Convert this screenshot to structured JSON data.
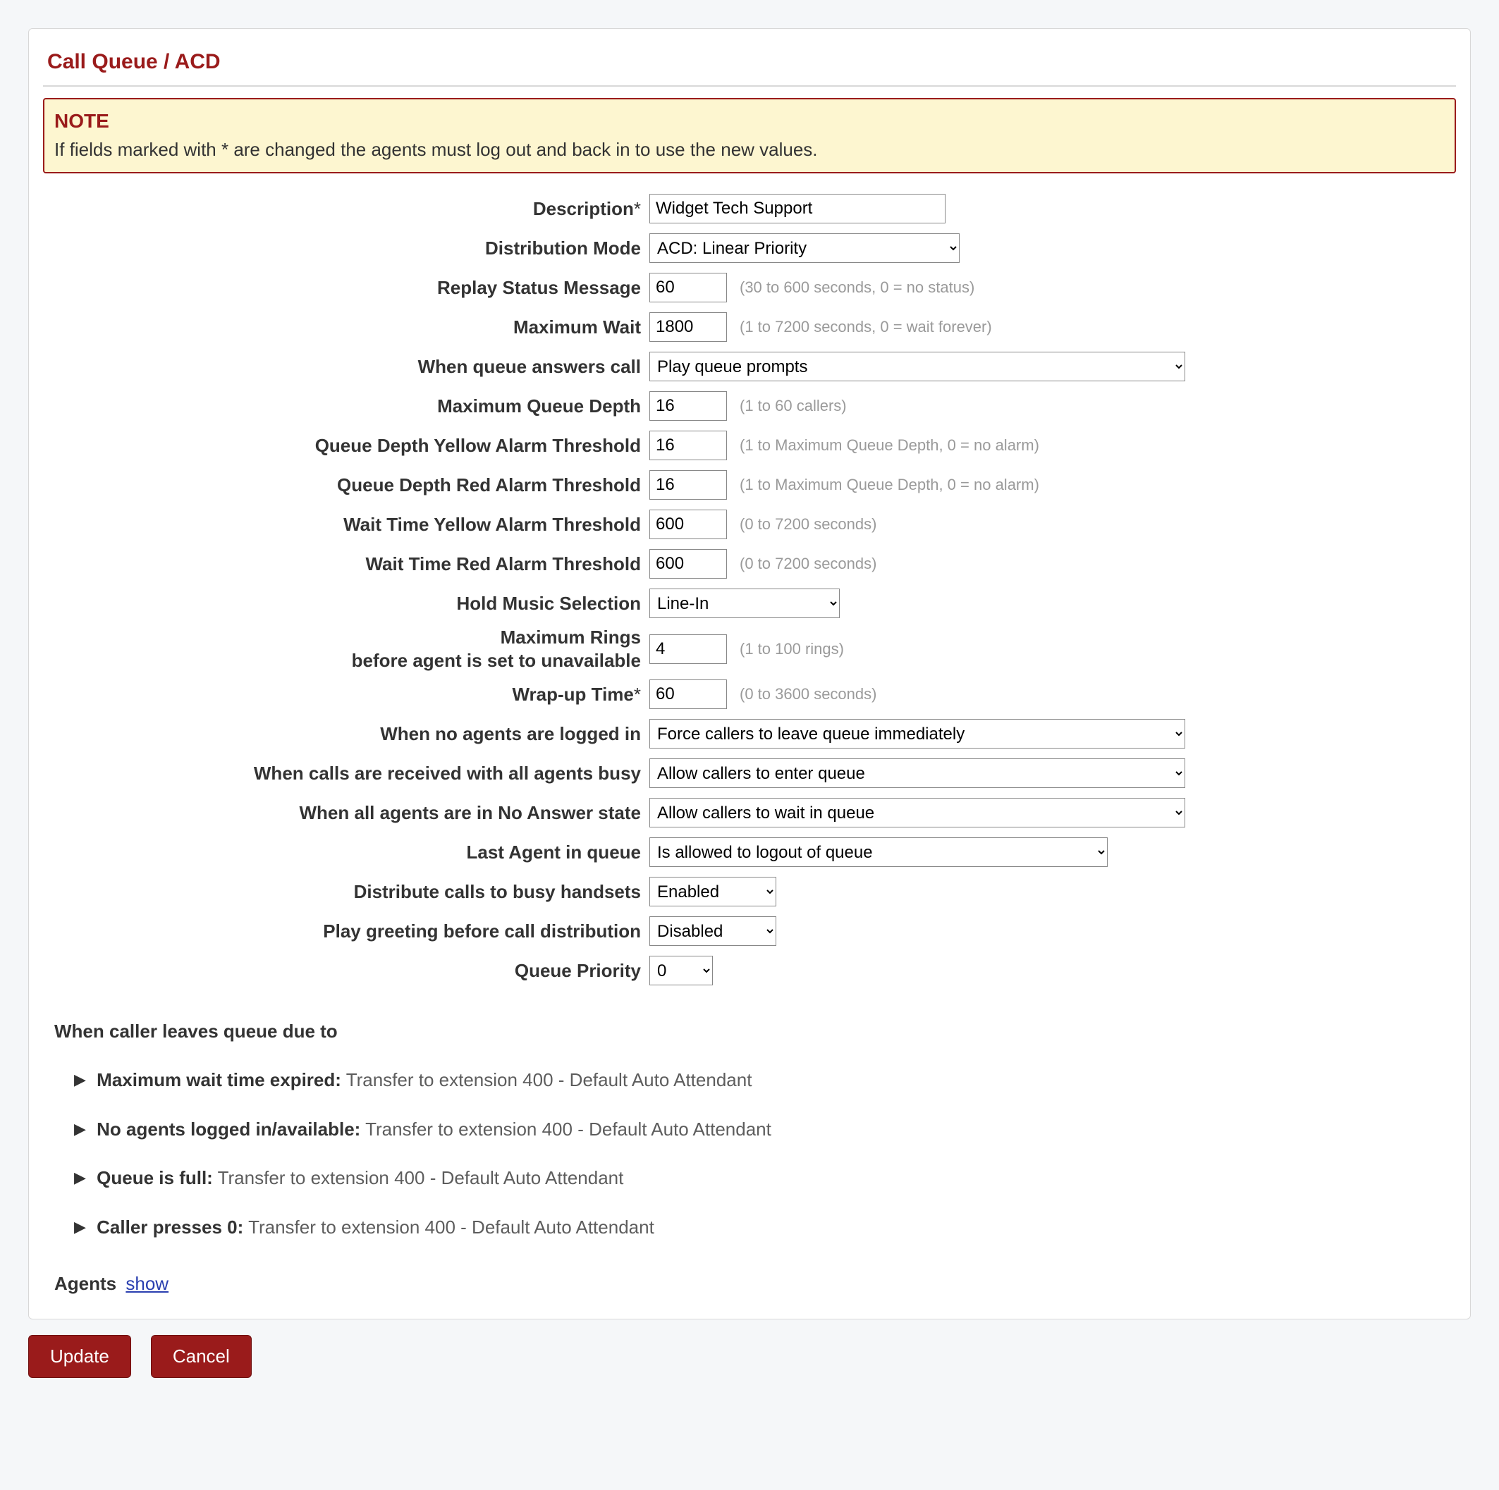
{
  "panel": {
    "title": "Call Queue / ACD"
  },
  "note": {
    "title": "NOTE",
    "text": "If fields marked with * are changed the agents must log out and back in to use the new values."
  },
  "fields": {
    "description": {
      "label": "Description",
      "star": "*",
      "value": "Widget Tech Support"
    },
    "dist_mode": {
      "label": "Distribution Mode",
      "value": "ACD: Linear Priority"
    },
    "replay_status": {
      "label": "Replay Status Message",
      "value": "60",
      "hint": "(30 to 600 seconds, 0 = no status)"
    },
    "max_wait": {
      "label": "Maximum Wait",
      "value": "1800",
      "hint": "(1 to 7200 seconds, 0 = wait forever)"
    },
    "queue_answers": {
      "label": "When queue answers call",
      "value": "Play queue prompts"
    },
    "max_depth": {
      "label": "Maximum Queue Depth",
      "value": "16",
      "hint": "(1 to 60 callers)"
    },
    "depth_yellow": {
      "label": "Queue Depth Yellow Alarm Threshold",
      "value": "16",
      "hint": "(1 to Maximum Queue Depth, 0 = no alarm)"
    },
    "depth_red": {
      "label": "Queue Depth Red Alarm Threshold",
      "value": "16",
      "hint": "(1 to Maximum Queue Depth, 0 = no alarm)"
    },
    "wait_yellow": {
      "label": "Wait Time Yellow Alarm Threshold",
      "value": "600",
      "hint": "(0 to 7200 seconds)"
    },
    "wait_red": {
      "label": "Wait Time Red Alarm Threshold",
      "value": "600",
      "hint": "(0 to 7200 seconds)"
    },
    "hold_music": {
      "label": "Hold Music Selection",
      "value": "Line-In"
    },
    "max_rings": {
      "label": "Maximum Rings\nbefore agent is set to unavailable",
      "value": "4",
      "hint": "(1 to 100 rings)"
    },
    "wrap_up": {
      "label": "Wrap-up Time",
      "star": "*",
      "value": "60",
      "hint": "(0 to 3600 seconds)"
    },
    "no_agents": {
      "label": "When no agents are logged in",
      "value": "Force callers to leave queue immediately"
    },
    "all_busy": {
      "label": "When calls are received with all agents busy",
      "value": "Allow callers to enter queue"
    },
    "all_no_answer": {
      "label": "When all agents are in No Answer state",
      "value": "Allow callers to wait in queue"
    },
    "last_agent": {
      "label": "Last Agent in queue",
      "value": "Is allowed to logout of queue"
    },
    "dist_busy": {
      "label": "Distribute calls to busy handsets",
      "value": "Enabled"
    },
    "play_greeting": {
      "label": "Play greeting before call distribution",
      "value": "Disabled"
    },
    "queue_priority": {
      "label": "Queue Priority",
      "value": "0"
    }
  },
  "leave": {
    "heading": "When caller leaves queue due to",
    "items": [
      {
        "label": "Maximum wait time expired:",
        "value": "Transfer to extension 400 - Default Auto Attendant"
      },
      {
        "label": "No agents logged in/available:",
        "value": "Transfer to extension 400 - Default Auto Attendant"
      },
      {
        "label": "Queue is full:",
        "value": "Transfer to extension 400 - Default Auto Attendant"
      },
      {
        "label": "Caller presses 0:",
        "value": "Transfer to extension 400 - Default Auto Attendant"
      }
    ]
  },
  "agents": {
    "label": "Agents",
    "link": "show"
  },
  "buttons": {
    "update": "Update",
    "cancel": "Cancel"
  }
}
